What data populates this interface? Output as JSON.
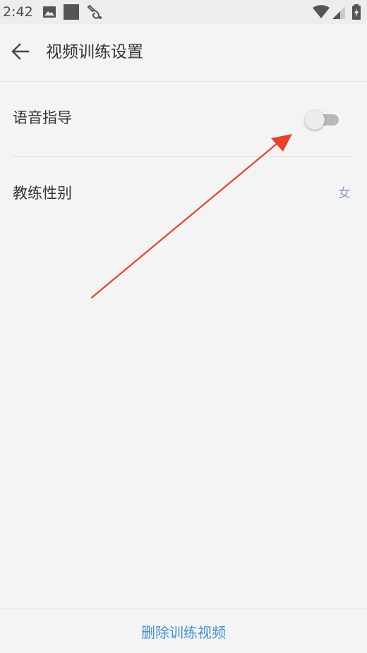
{
  "status_bar": {
    "time": "2:42",
    "left_icons": [
      "image-icon",
      "square-notification-icon",
      "gesture-notification-icon"
    ],
    "right_icons": [
      "wifi-icon",
      "cell-signal-icon",
      "battery-charging-icon"
    ]
  },
  "app_bar": {
    "back_icon": "arrow-left-icon",
    "title": "视频训练设置"
  },
  "settings": {
    "voice_guidance": {
      "label": "语音指导",
      "enabled": false
    },
    "coach_gender": {
      "label": "教练性别",
      "value": "女"
    }
  },
  "annotation": {
    "type": "arrow",
    "color": "#e8412f",
    "points_to": "voice-guidance-toggle"
  },
  "bottom": {
    "delete_label": "删除训练视频"
  },
  "colors": {
    "background": "#f4f4f4",
    "status_bar": "#ededed",
    "accent_link": "#3f8fd8",
    "value_text": "#8aa4bf",
    "toggle_off_track": "#b9b9b9",
    "toggle_off_thumb": "#ececec"
  }
}
